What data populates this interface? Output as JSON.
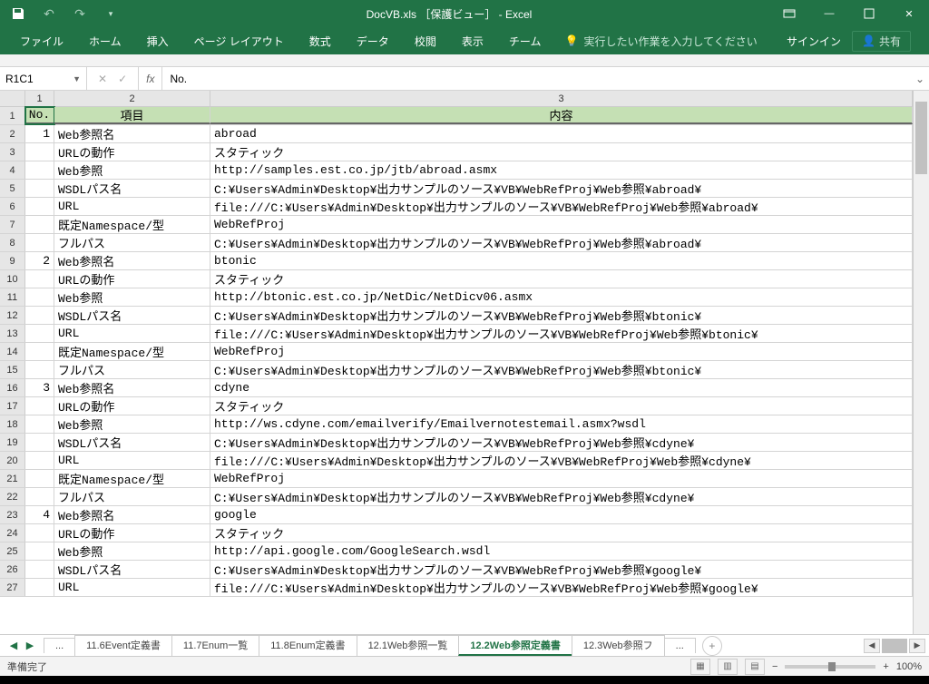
{
  "title": "DocVB.xls ［保護ビュー］ - Excel",
  "qat": {
    "save": "💾",
    "undo": "↶",
    "redo": "↷"
  },
  "win": {
    "rib": "▢",
    "min": "—",
    "max": "❐",
    "close": "✕"
  },
  "ribbon": {
    "tabs": [
      "ファイル",
      "ホーム",
      "挿入",
      "ページ レイアウト",
      "数式",
      "データ",
      "校閲",
      "表示",
      "チーム"
    ],
    "tellme": "実行したい作業を入力してください",
    "signin": "サインイン",
    "share": "共有"
  },
  "namebox": "R1C1",
  "fxvalue": "No.",
  "colnums": [
    "1",
    "2",
    "3"
  ],
  "headers": {
    "no": "No.",
    "item": "項目",
    "content": "内容"
  },
  "rows": [
    {
      "r": "2",
      "n": "1",
      "item": "Web参照名",
      "content": "abroad"
    },
    {
      "r": "3",
      "n": "",
      "item": "URLの動作",
      "content": "スタティック"
    },
    {
      "r": "4",
      "n": "",
      "item": "Web参照",
      "content": "http://samples.est.co.jp/jtb/abroad.asmx"
    },
    {
      "r": "5",
      "n": "",
      "item": "WSDLパス名",
      "content": "C:¥Users¥Admin¥Desktop¥出力サンプルのソース¥VB¥WebRefProj¥Web参照¥abroad¥"
    },
    {
      "r": "6",
      "n": "",
      "item": "URL",
      "content": "file:///C:¥Users¥Admin¥Desktop¥出力サンプルのソース¥VB¥WebRefProj¥Web参照¥abroad¥"
    },
    {
      "r": "7",
      "n": "",
      "item": "既定Namespace/型",
      "content": "WebRefProj"
    },
    {
      "r": "8",
      "n": "",
      "item": "フルパス",
      "content": "C:¥Users¥Admin¥Desktop¥出力サンプルのソース¥VB¥WebRefProj¥Web参照¥abroad¥"
    },
    {
      "r": "9",
      "n": "2",
      "item": "Web参照名",
      "content": "btonic"
    },
    {
      "r": "10",
      "n": "",
      "item": "URLの動作",
      "content": "スタティック"
    },
    {
      "r": "11",
      "n": "",
      "item": "Web参照",
      "content": "http://btonic.est.co.jp/NetDic/NetDicv06.asmx"
    },
    {
      "r": "12",
      "n": "",
      "item": "WSDLパス名",
      "content": "C:¥Users¥Admin¥Desktop¥出力サンプルのソース¥VB¥WebRefProj¥Web参照¥btonic¥"
    },
    {
      "r": "13",
      "n": "",
      "item": "URL",
      "content": "file:///C:¥Users¥Admin¥Desktop¥出力サンプルのソース¥VB¥WebRefProj¥Web参照¥btonic¥"
    },
    {
      "r": "14",
      "n": "",
      "item": "既定Namespace/型",
      "content": "WebRefProj"
    },
    {
      "r": "15",
      "n": "",
      "item": "フルパス",
      "content": "C:¥Users¥Admin¥Desktop¥出力サンプルのソース¥VB¥WebRefProj¥Web参照¥btonic¥"
    },
    {
      "r": "16",
      "n": "3",
      "item": "Web参照名",
      "content": "cdyne"
    },
    {
      "r": "17",
      "n": "",
      "item": "URLの動作",
      "content": "スタティック"
    },
    {
      "r": "18",
      "n": "",
      "item": "Web参照",
      "content": "http://ws.cdyne.com/emailverify/Emailvernotestemail.asmx?wsdl"
    },
    {
      "r": "19",
      "n": "",
      "item": "WSDLパス名",
      "content": "C:¥Users¥Admin¥Desktop¥出力サンプルのソース¥VB¥WebRefProj¥Web参照¥cdyne¥"
    },
    {
      "r": "20",
      "n": "",
      "item": "URL",
      "content": "file:///C:¥Users¥Admin¥Desktop¥出力サンプルのソース¥VB¥WebRefProj¥Web参照¥cdyne¥"
    },
    {
      "r": "21",
      "n": "",
      "item": "既定Namespace/型",
      "content": "WebRefProj"
    },
    {
      "r": "22",
      "n": "",
      "item": "フルパス",
      "content": "C:¥Users¥Admin¥Desktop¥出力サンプルのソース¥VB¥WebRefProj¥Web参照¥cdyne¥"
    },
    {
      "r": "23",
      "n": "4",
      "item": "Web参照名",
      "content": "google"
    },
    {
      "r": "24",
      "n": "",
      "item": "URLの動作",
      "content": "スタティック"
    },
    {
      "r": "25",
      "n": "",
      "item": "Web参照",
      "content": "http://api.google.com/GoogleSearch.wsdl"
    },
    {
      "r": "26",
      "n": "",
      "item": "WSDLパス名",
      "content": "C:¥Users¥Admin¥Desktop¥出力サンプルのソース¥VB¥WebRefProj¥Web参照¥google¥"
    },
    {
      "r": "27",
      "n": "",
      "item": "URL",
      "content": "file:///C:¥Users¥Admin¥Desktop¥出力サンプルのソース¥VB¥WebRefProj¥Web参照¥google¥"
    }
  ],
  "sheettabs": {
    "more_left": "...",
    "tabs": [
      "11.6Event定義書",
      "11.7Enum一覧",
      "11.8Enum定義書",
      "12.1Web参照一覧",
      "12.2Web参照定義書",
      "12.3Web参照フ"
    ],
    "more_right": "...",
    "active_index": 4
  },
  "status": {
    "ready": "準備完了",
    "zoom": "100%"
  }
}
